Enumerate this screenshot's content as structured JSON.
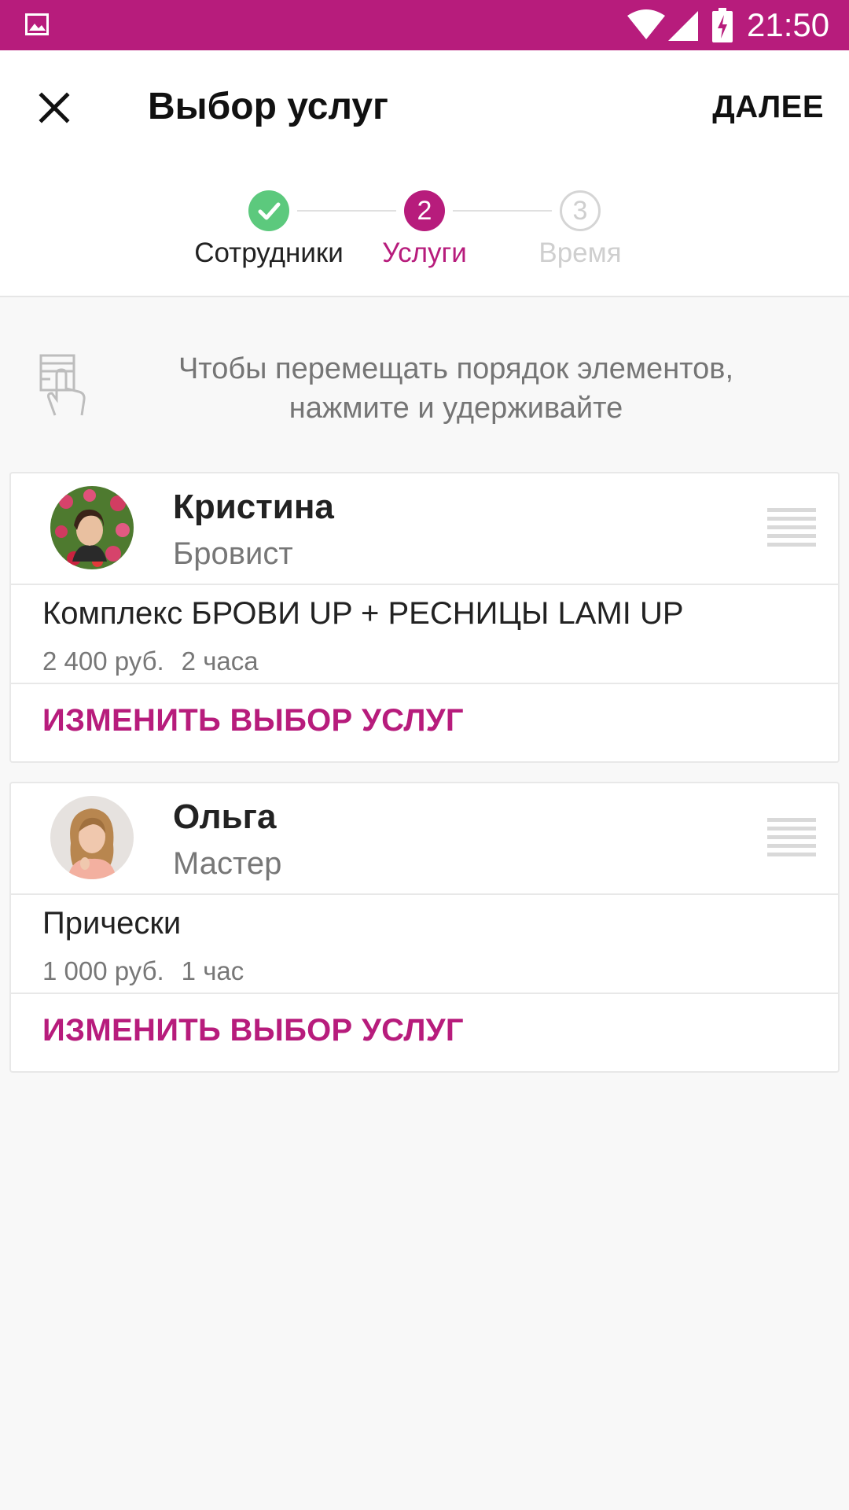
{
  "status_bar": {
    "time": "21:50",
    "icons": [
      "image-notification-icon",
      "wifi-icon",
      "signal-icon",
      "battery-charging-icon"
    ],
    "bg_color": "#b71c7c"
  },
  "app_bar": {
    "title": "Выбор услуг",
    "next_label": "ДАЛЕЕ",
    "close_icon": "close-icon"
  },
  "stepper": {
    "steps": [
      {
        "number": "1",
        "label": "Сотрудники",
        "state": "done"
      },
      {
        "number": "2",
        "label": "Услуги",
        "state": "active"
      },
      {
        "number": "3",
        "label": "Время",
        "state": "upcoming"
      }
    ],
    "done_color": "#5cc97d",
    "active_color": "#b71c7c",
    "upcoming_color": "#cfcfcf"
  },
  "hint": {
    "text_line1": "Чтобы перемещать порядок элементов,",
    "text_line2": "нажмите и удерживайте",
    "icon": "touch-hold-icon"
  },
  "cards": [
    {
      "name": "Кристина",
      "role": "Бровист",
      "service": "Комплекс БРОВИ UP + РЕСНИЦЫ LAMI UP",
      "price": "2 400 руб.",
      "duration": "2 часа",
      "change_label": "ИЗМЕНИТЬ ВЫБОР УСЛУГ"
    },
    {
      "name": "Ольга",
      "role": "Мастер",
      "service": "Прически",
      "price": "1 000 руб.",
      "duration": "1 час",
      "change_label": "ИЗМЕНИТЬ ВЫБОР УСЛУГ"
    }
  ]
}
